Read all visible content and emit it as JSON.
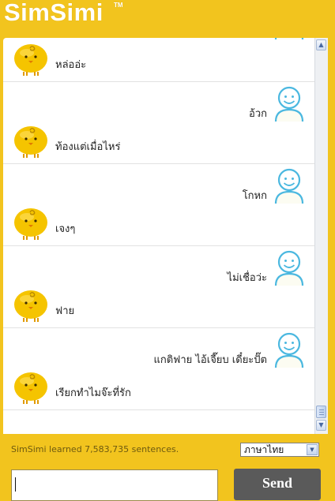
{
  "app": {
    "logo_text": "SimSimi",
    "trademark": "TM"
  },
  "chat": {
    "exchanges": [
      {
        "user": "แสน เชิง",
        "bot": "หล่ออ่ะ"
      },
      {
        "user": "อ้วก",
        "bot": "ท้องแต่เมื่อไหร่"
      },
      {
        "user": "โกหก",
        "bot": "เจงๆ"
      },
      {
        "user": "ไม่เชื่อว่ะ",
        "bot": "ฟาย"
      },
      {
        "user": "แกติฟาย ไอ้เจี๊ยบ เดี๋ยะปั๊ต",
        "bot": "เรียกทำไมจ๊ะที่รัก"
      }
    ],
    "icons": {
      "user": "user-avatar-icon",
      "bot": "simsimi-chick-icon"
    }
  },
  "footer": {
    "learned_text": "SimSimi learned 7,583,735 sentences.",
    "language_selected": "ภาษาไทย",
    "input_value": "",
    "send_label": "Send"
  },
  "colors": {
    "background": "#f2c41e",
    "chick": "#f5c400",
    "user_icon": "#4bb8e0",
    "send_button": "#5a5a5a"
  }
}
